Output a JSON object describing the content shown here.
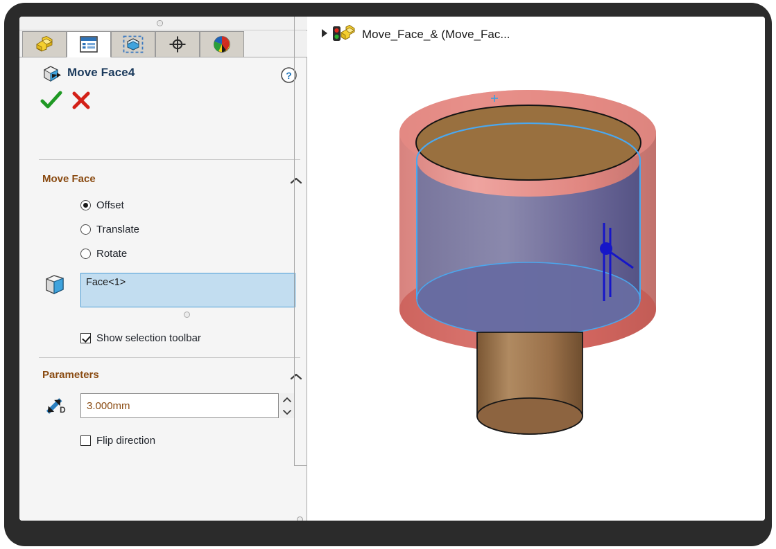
{
  "window": {
    "bezel_color": "#2b2b2b",
    "canvas_bg": "#ffffff"
  },
  "left_panel": {
    "splitter_handle": "splitter-handle",
    "tabs": [
      {
        "name": "feature-manager-design-tree",
        "icon": "yellow-block-icon",
        "active": false
      },
      {
        "name": "property-manager",
        "icon": "property-list-icon",
        "active": true
      },
      {
        "name": "configuration-manager",
        "icon": "configuration-cube-icon",
        "active": false
      },
      {
        "name": "dimxpert-manager",
        "icon": "crosshair-target-icon",
        "active": false
      },
      {
        "name": "display-manager",
        "icon": "color-sphere-icon",
        "active": false
      }
    ],
    "header": {
      "icon": "move-face-icon",
      "title": "Move Face4",
      "help_icon": "help-question-icon"
    },
    "actions": {
      "ok": {
        "icon": "green-check-icon",
        "label": "OK"
      },
      "cancel": {
        "icon": "red-x-icon",
        "label": "Cancel"
      }
    },
    "groups": [
      {
        "id": "move-face",
        "label": "Move Face",
        "collapse_icon": "chevron-up-icon",
        "radios": [
          {
            "label": "Offset",
            "selected": true
          },
          {
            "label": "Translate",
            "selected": false
          },
          {
            "label": "Rotate",
            "selected": false
          }
        ],
        "selection": {
          "icon": "face-cube-icon",
          "value": "Face<1>",
          "placeholder": "",
          "highlight_color": "#c2ddf0",
          "border_color": "#4a9cd4"
        },
        "checkbox": {
          "label": "Show selection toolbar",
          "checked": true
        }
      },
      {
        "id": "parameters",
        "label": "Parameters",
        "collapse_icon": "chevron-up-icon",
        "distance": {
          "icon": "distance-d-icon",
          "value": "3.000mm",
          "spin_up": "spinner-up-icon",
          "spin_down": "spinner-down-icon"
        },
        "checkbox": {
          "label": "Flip direction",
          "checked": false
        }
      }
    ]
  },
  "graphics": {
    "tree_item": {
      "expand_icon": "triangle-right-icon",
      "status_icon": "traffic-light-rebuild-icon",
      "label": "Move_Face_& (Move_Fac..."
    },
    "model": {
      "name": "cylindrical-boss-part",
      "preview_face_color": "#e0564f",
      "selected_face_color": "#6b6fa0",
      "body_color": "#a57a52",
      "top_face_color": "#9c7044",
      "edge_highlight_color": "#4aa8f0",
      "manipulator_color": "#1616c8"
    }
  }
}
